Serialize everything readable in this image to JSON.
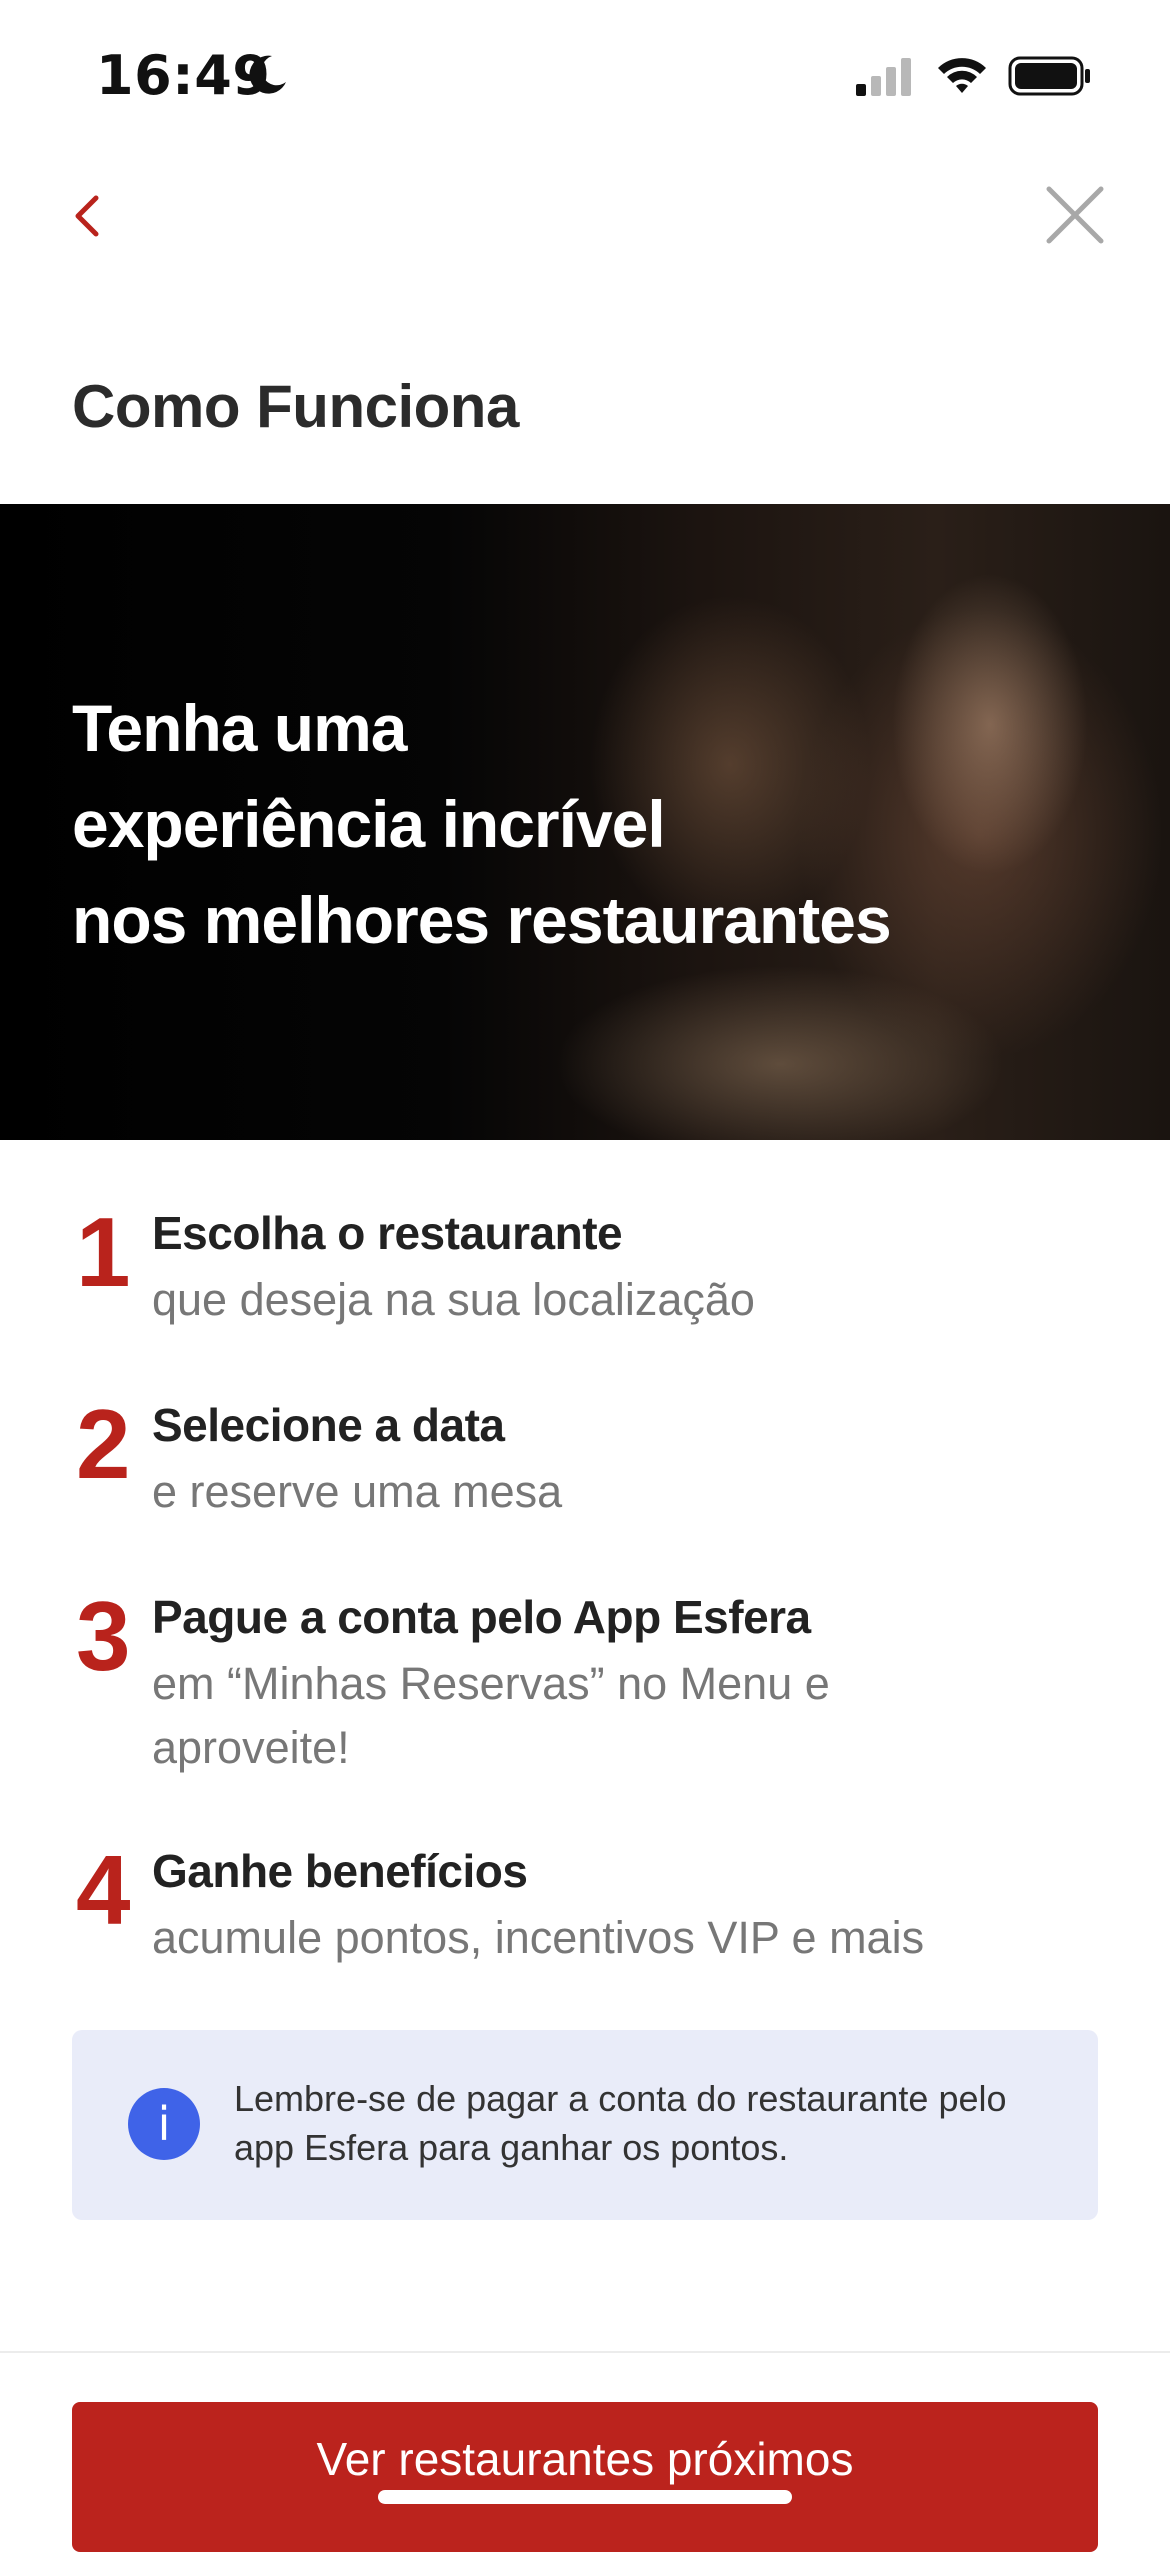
{
  "status_bar": {
    "time": "16:49",
    "icons": [
      "moon-icon",
      "cellular-signal-icon",
      "wifi-icon",
      "battery-icon"
    ]
  },
  "nav": {
    "back_icon": "chevron-left-icon",
    "close_icon": "close-icon"
  },
  "page": {
    "title": "Como Funciona"
  },
  "hero": {
    "headline_lines": [
      "Tenha uma",
      "experiência incrível",
      "nos melhores restaurantes"
    ]
  },
  "steps": [
    {
      "number": "1",
      "title": "Escolha o restaurante",
      "description": "que deseja na sua localização"
    },
    {
      "number": "2",
      "title": "Selecione a data",
      "description": "e reserve uma mesa"
    },
    {
      "number": "3",
      "title": "Pague a conta pelo App Esfera",
      "description": "em “Minhas Reservas” no Menu e aproveite!"
    },
    {
      "number": "4",
      "title": "Ganhe benefícios",
      "description": "acumule pontos, incentivos VIP e mais"
    }
  ],
  "info": {
    "icon": "info-icon",
    "icon_glyph": "i",
    "text": "Lembre-se de pagar a conta do restaurante pelo app Esfera para ganhar os pontos."
  },
  "cta": {
    "label": "Ver restaurantes próximos"
  },
  "colors": {
    "brand_red": "#bb231d",
    "info_blue": "#3f63e8",
    "info_bg": "#e9ecf9"
  }
}
